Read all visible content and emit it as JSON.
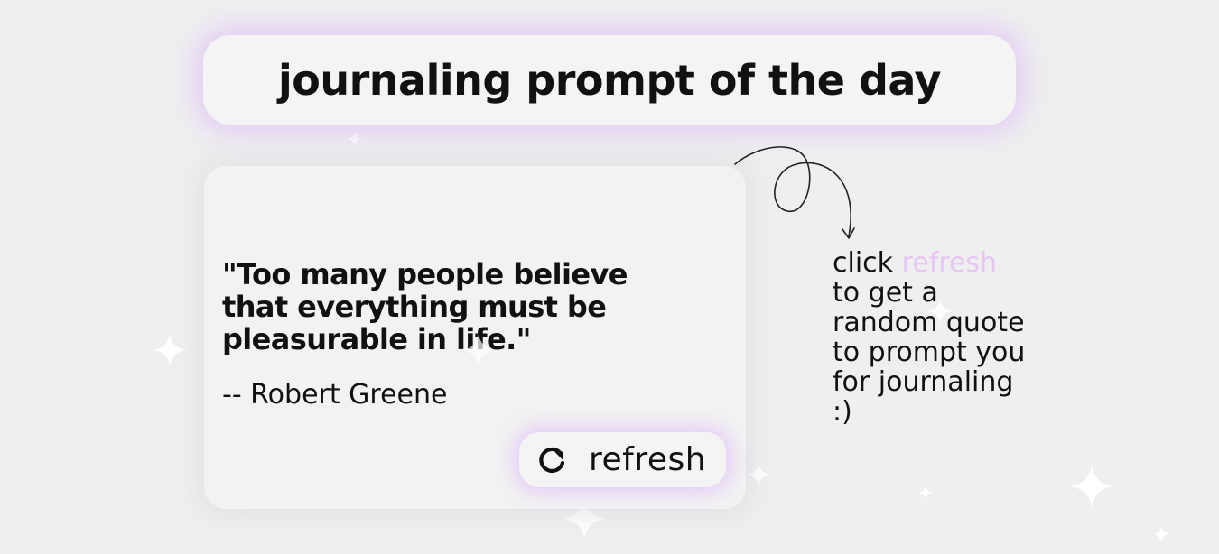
{
  "header": {
    "title": "journaling prompt of the day"
  },
  "quote": {
    "text": "\"Too many people believe that everything must be pleasurable in life.\"",
    "author": "-- Robert Greene"
  },
  "refresh_button": {
    "label": "refresh",
    "icon": "refresh-icon"
  },
  "hint": {
    "prefix": "click ",
    "highlight": "refresh",
    "suffix": " to get a random quote to prompt you for journaling :)"
  },
  "colors": {
    "background": "#efefef",
    "accent_glow": "#dcbef5",
    "highlight_text": "#e7c6f3",
    "text": "#111111"
  }
}
